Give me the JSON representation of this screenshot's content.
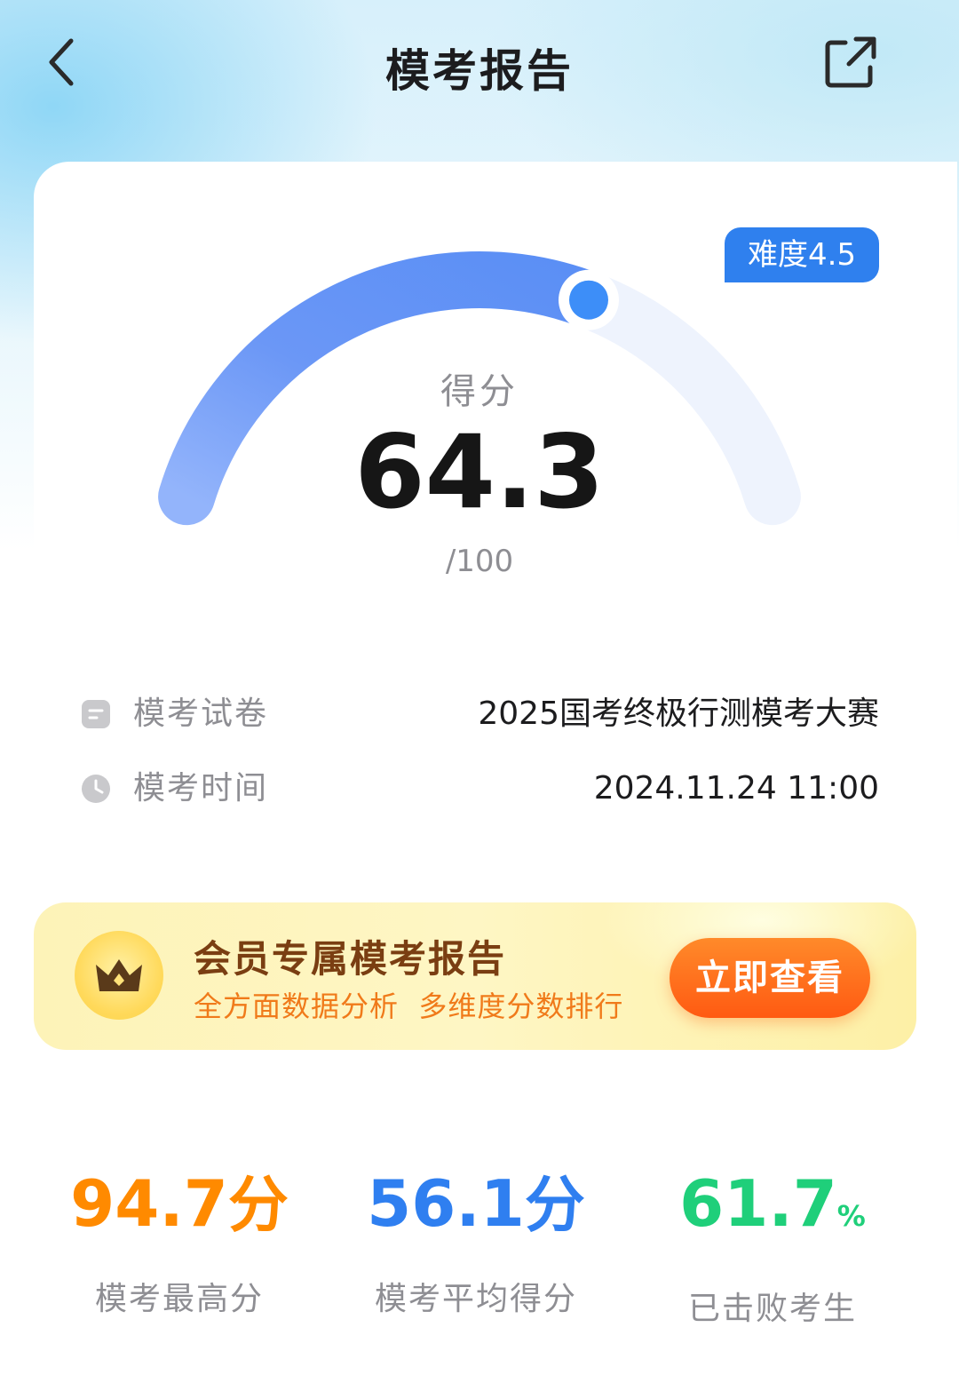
{
  "header": {
    "title": "模考报告",
    "back_icon": "chevron-left-icon",
    "share_icon": "share-external-icon"
  },
  "score_card": {
    "difficulty": "难度4.5",
    "label": "得分",
    "score": "64.3",
    "total": "/100",
    "progress_fraction": 0.643,
    "gauge_color": "#5b8ff5",
    "badge_color": "#2f80ee"
  },
  "exam_info": {
    "paper_label": "模考试卷",
    "paper_value": "2025国考终极行测模考大赛",
    "time_label": "模考时间",
    "time_value": "2024.11.24 11:00"
  },
  "vip_banner": {
    "title": "会员专属模考报告",
    "subtitle": "全方面数据分析  多维度分数排行",
    "button_label": "立即查看",
    "icon": "crown-icon"
  },
  "stats": [
    {
      "value": "94.7",
      "unit": "分",
      "label": "模考最高分",
      "color": "#ff8a00"
    },
    {
      "value": "56.1",
      "unit": "分",
      "label": "模考平均得分",
      "color": "#2f7ff0"
    },
    {
      "value": "61.7",
      "unit": "%",
      "label": "已击败考生",
      "color": "#1fcf7a"
    }
  ]
}
